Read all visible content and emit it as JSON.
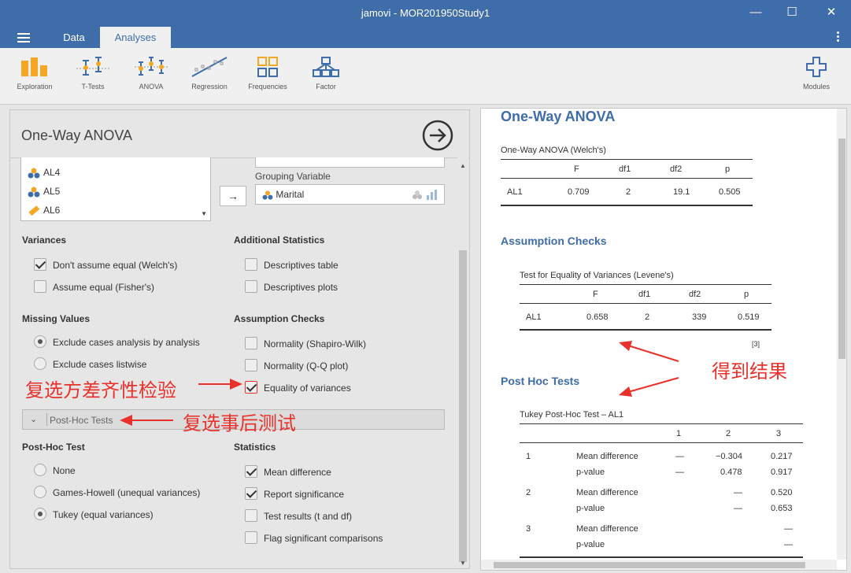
{
  "window": {
    "title": "jamovi - MOR201950Study1",
    "minimize": "—",
    "maximize": "☐",
    "close": "✕"
  },
  "menu": {
    "tabs": [
      "Data",
      "Analyses"
    ]
  },
  "ribbon": {
    "items": [
      "Exploration",
      "T-Tests",
      "ANOVA",
      "Regression",
      "Frequencies",
      "Factor"
    ],
    "modules": "Modules"
  },
  "left": {
    "title": "One-Way ANOVA",
    "variables": [
      "AL4",
      "AL5",
      "AL6"
    ],
    "grouping_label": "Grouping Variable",
    "grouping_value": "Marital",
    "variances": {
      "heading": "Variances",
      "options": [
        {
          "label": "Don't assume equal (Welch's)",
          "checked": true
        },
        {
          "label": "Assume equal (Fisher's)",
          "checked": false
        }
      ]
    },
    "additional": {
      "heading": "Additional Statistics",
      "options": [
        {
          "label": "Descriptives table",
          "checked": false
        },
        {
          "label": "Descriptives plots",
          "checked": false
        }
      ]
    },
    "missing": {
      "heading": "Missing Values",
      "options": [
        {
          "label": "Exclude cases analysis by analysis",
          "selected": true
        },
        {
          "label": "Exclude cases listwise",
          "selected": false
        }
      ]
    },
    "assumption": {
      "heading": "Assumption Checks",
      "options": [
        {
          "label": "Normality (Shapiro-Wilk)",
          "checked": false
        },
        {
          "label": "Normality (Q-Q plot)",
          "checked": false
        },
        {
          "label": "Equality of variances",
          "checked": true
        }
      ]
    },
    "posthoc_bar": "Post-Hoc Tests",
    "posthoc": {
      "heading": "Post-Hoc Test",
      "options": [
        {
          "label": "None",
          "selected": false
        },
        {
          "label": "Games-Howell (unequal variances)",
          "selected": false
        },
        {
          "label": "Tukey (equal variances)",
          "selected": true
        }
      ]
    },
    "statistics": {
      "heading": "Statistics",
      "options": [
        {
          "label": "Mean difference",
          "checked": true
        },
        {
          "label": "Report significance",
          "checked": true
        },
        {
          "label": "Test results (t and df)",
          "checked": false
        },
        {
          "label": "Flag significant comparisons",
          "checked": false
        }
      ]
    }
  },
  "results": {
    "title": "One-Way ANOVA",
    "welch": {
      "title": "One-Way ANOVA (Welch's)",
      "headers": [
        "",
        "F",
        "df1",
        "df2",
        "p"
      ],
      "row": [
        "AL1",
        "0.709",
        "2",
        "19.1",
        "0.505"
      ]
    },
    "assumption_title": "Assumption Checks",
    "levene": {
      "title": "Test for Equality of Variances (Levene's)",
      "headers": [
        "",
        "F",
        "df1",
        "df2",
        "p"
      ],
      "row": [
        "AL1",
        "0.658",
        "2",
        "339",
        "0.519"
      ],
      "footnote": "[3]"
    },
    "posthoc_title": "Post Hoc Tests",
    "tukey": {
      "title": "Tukey Post-Hoc Test – AL1",
      "headers": [
        "1",
        "2",
        "3"
      ],
      "rows": [
        {
          "group": "1",
          "md_label": "Mean difference",
          "md": [
            "—",
            "−0.304",
            "0.217"
          ],
          "p_label": "p-value",
          "p": [
            "—",
            "0.478",
            "0.917"
          ]
        },
        {
          "group": "2",
          "md_label": "Mean difference",
          "md": [
            "",
            "—",
            "0.520"
          ],
          "p_label": "p-value",
          "p": [
            "",
            "—",
            "0.653"
          ]
        },
        {
          "group": "3",
          "md_label": "Mean difference",
          "md": [
            "",
            "",
            "—"
          ],
          "p_label": "p-value",
          "p": [
            "",
            "",
            "—"
          ]
        }
      ]
    }
  },
  "annotations": {
    "variance_check": "复选方差齐性检验",
    "posthoc": "复选事后测试",
    "result": "得到结果"
  },
  "colors": {
    "brand": "#3e6da9",
    "annotation": "#e8312a",
    "icon_orange": "#f5a623"
  }
}
